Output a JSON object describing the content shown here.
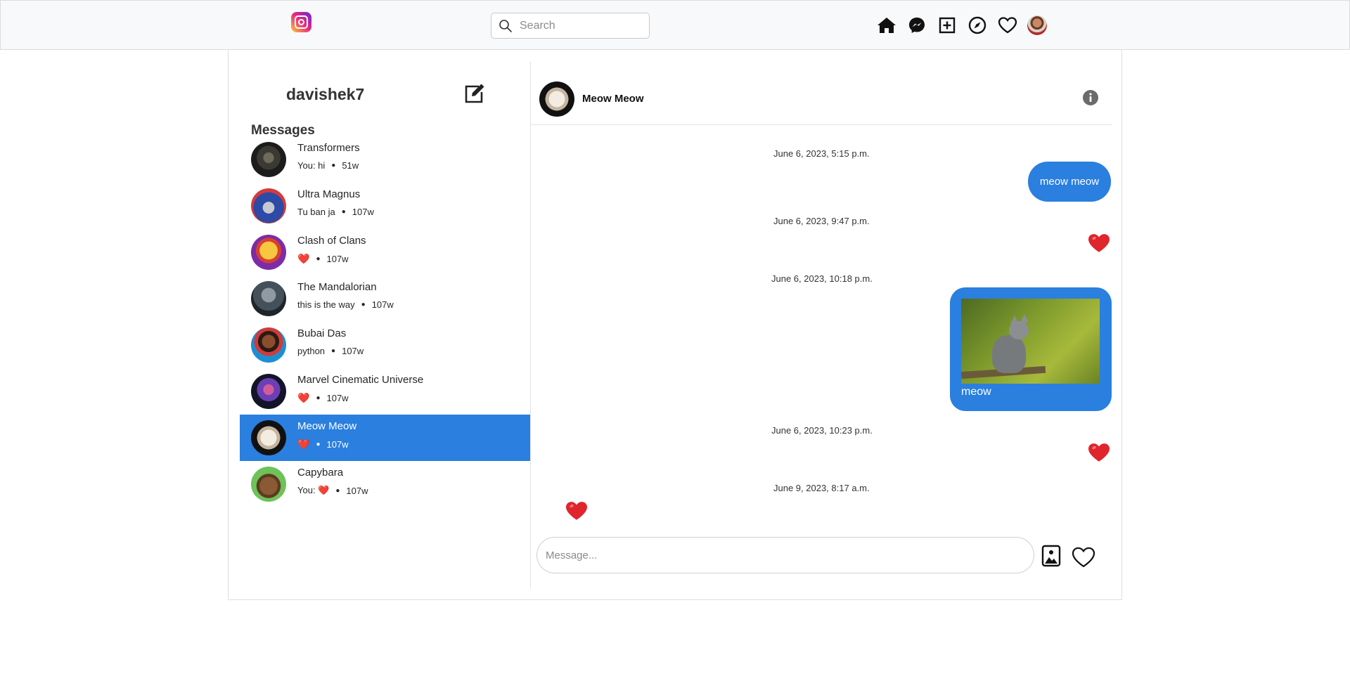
{
  "nav": {
    "logo_icon": "instagram-logo",
    "search_placeholder": "Search",
    "icons": [
      "home-icon",
      "messenger-icon",
      "plus-square-icon",
      "compass-icon",
      "heart-icon",
      "profile-avatar"
    ]
  },
  "sidebar": {
    "username": "davishek7",
    "messages_title": "Messages",
    "conversations": [
      {
        "name": "Transformers",
        "preview": "You: hi",
        "time": "51w"
      },
      {
        "name": "Ultra Magnus",
        "preview": "Tu ban ja",
        "time": "107w"
      },
      {
        "name": "Clash of Clans",
        "preview": "❤️",
        "time": "107w"
      },
      {
        "name": "The Mandalorian",
        "preview": "this is the way",
        "time": "107w"
      },
      {
        "name": "Bubai Das",
        "preview": "python",
        "time": "107w"
      },
      {
        "name": "Marvel Cinematic Universe",
        "preview": "❤️",
        "time": "107w"
      },
      {
        "name": "Meow Meow",
        "preview": "❤️",
        "time": "107w",
        "active": true
      },
      {
        "name": "Capybara",
        "preview": "You: ❤️",
        "time": "107w"
      }
    ]
  },
  "chat": {
    "contact_name": "Meow Meow",
    "messages": [
      {
        "timestamp": "June 6, 2023, 5:15 p.m.",
        "type": "text",
        "text": "meow meow"
      },
      {
        "timestamp": "June 6, 2023, 9:47 p.m.",
        "type": "heart"
      },
      {
        "timestamp": "June 6, 2023, 10:18 p.m.",
        "type": "image",
        "caption": "meow"
      },
      {
        "timestamp": "June 6, 2023, 10:23 p.m.",
        "type": "heart"
      },
      {
        "timestamp": "June 9, 2023, 8:17 a.m.",
        "type": "heart",
        "incoming": true
      }
    ],
    "composer_placeholder": "Message..."
  },
  "colors": {
    "accent": "#2a7fdf",
    "heart": "#e0252d",
    "topbar_bg": "#f8f9fa"
  }
}
